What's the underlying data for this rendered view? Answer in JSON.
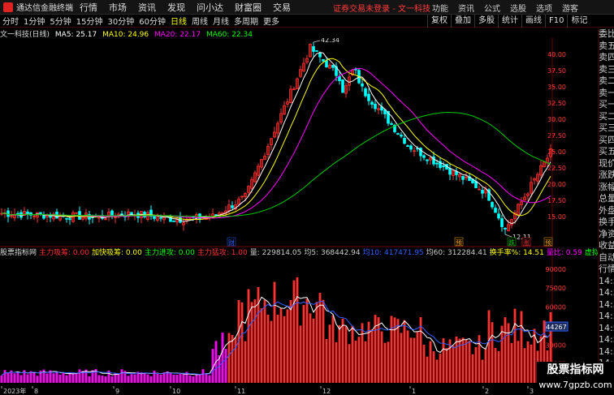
{
  "titlebar": {
    "app_title": "通达信金融终端",
    "menu": [
      "行情",
      "市场",
      "资讯",
      "发现",
      "问小达",
      "财富圈",
      "交易"
    ],
    "notice": "证券交易未登录",
    "stock": "文一科技",
    "right": [
      "功能",
      "资讯",
      "公式",
      "选股",
      "选项"
    ],
    "user": "游客"
  },
  "periods": [
    "分时",
    "1分钟",
    "5分钟",
    "15分钟",
    "30分钟",
    "60分钟",
    "日线",
    "周线",
    "月线",
    "多周期",
    "更多"
  ],
  "active_period": "日线",
  "toolbar_right": [
    "复权",
    "叠加",
    "多股",
    "统计",
    "画线",
    "F10",
    "标记"
  ],
  "main_header": {
    "name": "文一科技(日线)",
    "ma5": "MA5: 25.17",
    "ma10": "MA10: 24.96",
    "ma20": "MA20: 22.17",
    "ma60": "MA60: 22.34"
  },
  "colors": {
    "up": "#ff3232",
    "down": "#00ffff",
    "ma5": "#ffffff",
    "ma10": "#ffff00",
    "ma20": "#ff00ff",
    "ma60": "#00cc00",
    "grid": "#3a0000"
  },
  "price_axis": [
    "40.00",
    "37.50",
    "35.00",
    "32.50",
    "30.00",
    "27.50",
    "25.00",
    "22.50",
    "20.00",
    "17.50",
    "15.00"
  ],
  "price_labels": {
    "high": "42.34",
    "low": "12.11"
  },
  "chart_markers": [
    "财",
    "预",
    "跌",
    "涨",
    "预"
  ],
  "volume_header": {
    "name": "股票指标网",
    "items": [
      {
        "label": "主力吸筹: 0.00",
        "color": "#ff3232"
      },
      {
        "label": "加快吸筹: 0.00",
        "color": "#ffff00"
      },
      {
        "label": "主力进攻: 0.00",
        "color": "#00ff00"
      },
      {
        "label": "主力猛攻: 1.00",
        "color": "#ff3232"
      },
      {
        "label": "量: 229814.05",
        "color": "#cccccc"
      },
      {
        "label": "均5: 368442.94",
        "color": "#cccccc"
      },
      {
        "label": "均10: 417471.95",
        "color": "#3060ff"
      },
      {
        "label": "均60: 312284.41",
        "color": "#cccccc"
      },
      {
        "label": "换手率%: 14.51",
        "color": "#ffff00"
      },
      {
        "label": "量比: 0.59",
        "color": "#ff00ff"
      },
      {
        "label": "虚拟量比: 0.59",
        "color": "#00ff00"
      },
      {
        "label": "获利比例%",
        "color": "#00ffff"
      }
    ]
  },
  "volume_axis": [
    "90000",
    "75000",
    "60000",
    "45000",
    "30000",
    "15000"
  ],
  "volume_cursor": "44267",
  "dates": [
    "2023年",
    "8",
    "9",
    "10",
    "11",
    "12",
    "1",
    "2",
    "3"
  ],
  "side_panel": [
    "委比",
    "卖五",
    "卖四",
    "卖三",
    "卖二",
    "卖一",
    "买一",
    "买二",
    "买三",
    "买四",
    "买五",
    "现价",
    "涨跌",
    "涨幅",
    "总量",
    "外盘",
    "换手",
    "净资",
    "收益",
    "自动",
    "行情",
    "14:5",
    "14:5",
    "14:5",
    "14:5",
    "14:5",
    "14:5",
    "14:5",
    "14:5",
    "14:5"
  ],
  "watermark": {
    "line1": "股票指标网",
    "line2": "www.7gpzb.com"
  }
}
